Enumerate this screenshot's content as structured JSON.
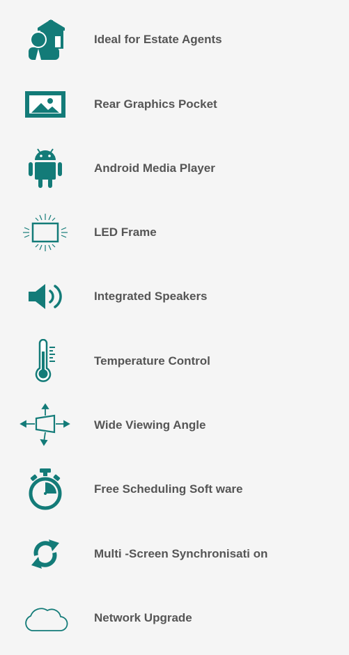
{
  "features": [
    {
      "label": "Ideal for Estate Agents",
      "icon": "estate-agent-icon"
    },
    {
      "label": "Rear Graphics Pocket",
      "icon": "picture-frame-icon"
    },
    {
      "label": "Android Media Player",
      "icon": "android-icon"
    },
    {
      "label": "LED Frame",
      "icon": "led-frame-icon"
    },
    {
      "label": "Integrated Speakers",
      "icon": "speaker-icon"
    },
    {
      "label": "Temperature Control",
      "icon": "thermometer-icon"
    },
    {
      "label": "Wide Viewing Angle",
      "icon": "viewing-angle-icon"
    },
    {
      "label": "Free Scheduling Soft ware",
      "icon": "stopwatch-icon"
    },
    {
      "label": "Multi -Screen Synchronisati on",
      "icon": "sync-icon"
    },
    {
      "label": "Network Upgrade",
      "icon": "cloud-icon"
    }
  ],
  "colors": {
    "accent": "#137b78",
    "text": "#555555",
    "background": "#f5f5f5"
  }
}
